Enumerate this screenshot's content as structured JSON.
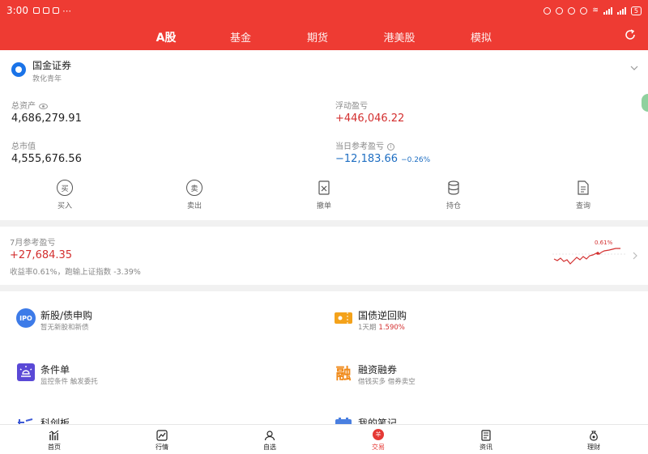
{
  "status_bar": {
    "time": "3:00",
    "battery": "5"
  },
  "tabs": [
    {
      "label": "A股",
      "active": true
    },
    {
      "label": "基金",
      "active": false
    },
    {
      "label": "期货",
      "active": false
    },
    {
      "label": "港美股",
      "active": false
    },
    {
      "label": "模拟",
      "active": false
    }
  ],
  "account": {
    "broker_name": "国金证券",
    "branch": "敦化青年",
    "total_assets_label": "总资产",
    "total_assets": "4,686,279.91",
    "floating_pnl_label": "浮动盈亏",
    "floating_pnl": "+446,046.22",
    "market_value_label": "总市值",
    "market_value": "4,555,676.56",
    "daily_pnl_label": "当日参考盈亏",
    "daily_pnl": "−12,183.66",
    "daily_pnl_pct": "−0.26%"
  },
  "actions": [
    {
      "label": "买入",
      "icon": "buy-icon",
      "glyph": "买"
    },
    {
      "label": "卖出",
      "icon": "sell-icon",
      "glyph": "卖"
    },
    {
      "label": "撤单",
      "icon": "cancel-order-icon",
      "glyph": ""
    },
    {
      "label": "持仓",
      "icon": "position-icon",
      "glyph": ""
    },
    {
      "label": "查询",
      "icon": "query-icon",
      "glyph": ""
    }
  ],
  "monthly": {
    "title": "7月参考盈亏",
    "value": "+27,684.35",
    "description": "收益率0.61%，跑输上证指数 -3.39%",
    "spark_label": "0.61%"
  },
  "services": [
    {
      "title": "新股/债申购",
      "subtitle": "暂无新股和新债",
      "icon": "ipo-icon",
      "glyph": "IPO"
    },
    {
      "title": "国债逆回购",
      "subtitle": "1天期",
      "highlight": "1.590%",
      "icon": "treasury-repo-icon"
    },
    {
      "title": "条件单",
      "subtitle": "监控条件 触发委托",
      "icon": "condition-order-icon"
    },
    {
      "title": "融资融券",
      "subtitle": "借钱买多 借券卖空",
      "icon": "margin-trading-icon",
      "glyph": "融"
    },
    {
      "title": "科创板",
      "icon": "star-market-icon"
    },
    {
      "title": "我的笔记",
      "icon": "notes-icon"
    }
  ],
  "bottom_nav": [
    {
      "label": "首页",
      "active": false
    },
    {
      "label": "行情",
      "active": false
    },
    {
      "label": "自选",
      "active": false
    },
    {
      "label": "交易",
      "active": true,
      "glyph": "羊"
    },
    {
      "label": "资讯",
      "active": false
    },
    {
      "label": "理财",
      "active": false
    }
  ],
  "colors": {
    "brand_red": "#ee3b33",
    "gain_red": "#d32f2f",
    "loss_blue": "#1e6ec2"
  }
}
